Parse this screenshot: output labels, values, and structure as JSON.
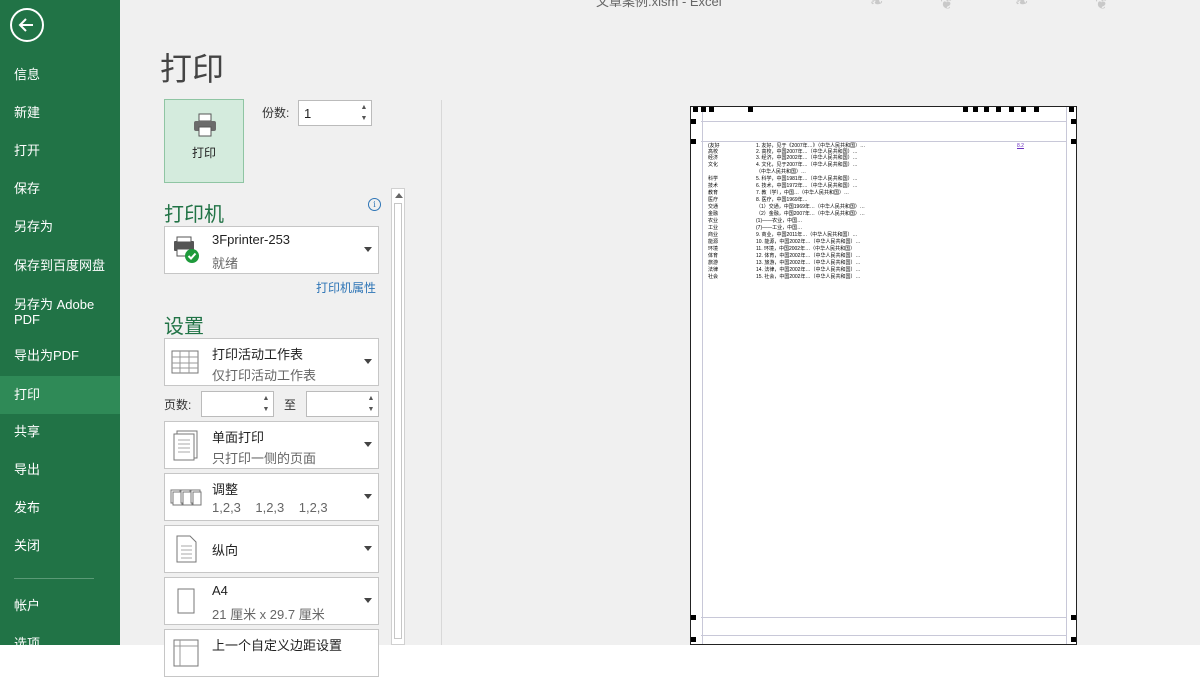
{
  "window": {
    "title": "文章案例.xlsm - Excel"
  },
  "sidebar": {
    "back_label": "back",
    "items": [
      {
        "label": "信息"
      },
      {
        "label": "新建"
      },
      {
        "label": "打开"
      },
      {
        "label": "保存"
      },
      {
        "label": "另存为"
      },
      {
        "label": "保存到百度网盘"
      },
      {
        "label": "另存为 Adobe PDF"
      },
      {
        "label": "导出为PDF"
      },
      {
        "label": "打印"
      },
      {
        "label": "共享"
      },
      {
        "label": "导出"
      },
      {
        "label": "发布"
      },
      {
        "label": "关闭"
      },
      {
        "label": "帐户"
      },
      {
        "label": "选项"
      }
    ],
    "active": "打印"
  },
  "print": {
    "title": "打印",
    "button_label": "打印",
    "copies_label": "份数:",
    "copies_value": "1"
  },
  "printer": {
    "heading": "打印机",
    "name": "3Fprinter-253",
    "status": "就绪",
    "properties_link": "打印机属性"
  },
  "settings": {
    "heading": "设置",
    "what": {
      "line1": "打印活动工作表",
      "line2": "仅打印活动工作表"
    },
    "pages_label": "页数:",
    "pages_to": "至",
    "pages_from_value": "",
    "pages_to_value": "",
    "sides": {
      "line1": "单面打印",
      "line2": "只打印一侧的页面"
    },
    "collate": {
      "line1": "调整",
      "line2": "1,2,3    1,2,3    1,2,3"
    },
    "orientation": {
      "line1": "纵向"
    },
    "paper": {
      "line1": "A4",
      "line2": "21 厘米 x 29.7 厘米"
    },
    "margins": {
      "line1": "上一个自定义边距设置"
    }
  },
  "preview": {
    "mark": "8.2",
    "rows": [
      {
        "c1": "(友好",
        "c2": "1. 友好，见于《2007年…》（中华人民共和国）…"
      },
      {
        "c1": "高校",
        "c2": "2. 高校，中国2007年…（中华人民共和国）…"
      },
      {
        "c1": "经济",
        "c2": "3. 经济，中国2002年…（中华人民共和国）…"
      },
      {
        "c1": "文化",
        "c2": "4. 文化，见于2007年…（中华人民共和国）…"
      },
      {
        "c1": "",
        "c2": "（中华人民共和国）…"
      },
      {
        "c1": "科学",
        "c2": "5. 科学，中国1981年…（中华人民共和国）…"
      },
      {
        "c1": "技术",
        "c2": "6. 技术，中国1972年…（中华人民共和国）…"
      },
      {
        "c1": "教育",
        "c2": "7. 教（学），中国…（中华人民共和国）…"
      },
      {
        "c1": "医疗",
        "c2": "8. 医疗，中国1969年…"
      },
      {
        "c1": "交通",
        "c2": "（1）交通，中国1969年…（中华人民共和国）…"
      },
      {
        "c1": "金融",
        "c2": "（2）金融，中国2007年…（中华人民共和国）…"
      },
      {
        "c1": "农业",
        "c2": "(1)——农业，中国…"
      },
      {
        "c1": "工业",
        "c2": "(7)——工业，中国…"
      },
      {
        "c1": "商业",
        "c2": "9. 商业，中国2011年…（中华人民共和国）…"
      },
      {
        "c1": "能源",
        "c2": "10. 能源，中国2002年…（中华人民共和国）…"
      },
      {
        "c1": "环境",
        "c2": "11. 环境，中国2002年…（中华人民共和国）"
      },
      {
        "c1": "体育",
        "c2": "12. 体育，中国2002年…（中华人民共和国）…"
      },
      {
        "c1": "旅游",
        "c2": "13. 旅游，中国2002年…（中华人民共和国）…"
      },
      {
        "c1": "法律",
        "c2": "14. 法律，中国2002年…（中华人民共和国）…"
      },
      {
        "c1": "社会",
        "c2": "15. 社会，中国2002年…（中华人民共和国）…"
      }
    ]
  },
  "colors": {
    "sidebar": "#217346",
    "sidebar_active": "#2f8a57",
    "accent": "#217346",
    "link": "#2e75b6"
  }
}
